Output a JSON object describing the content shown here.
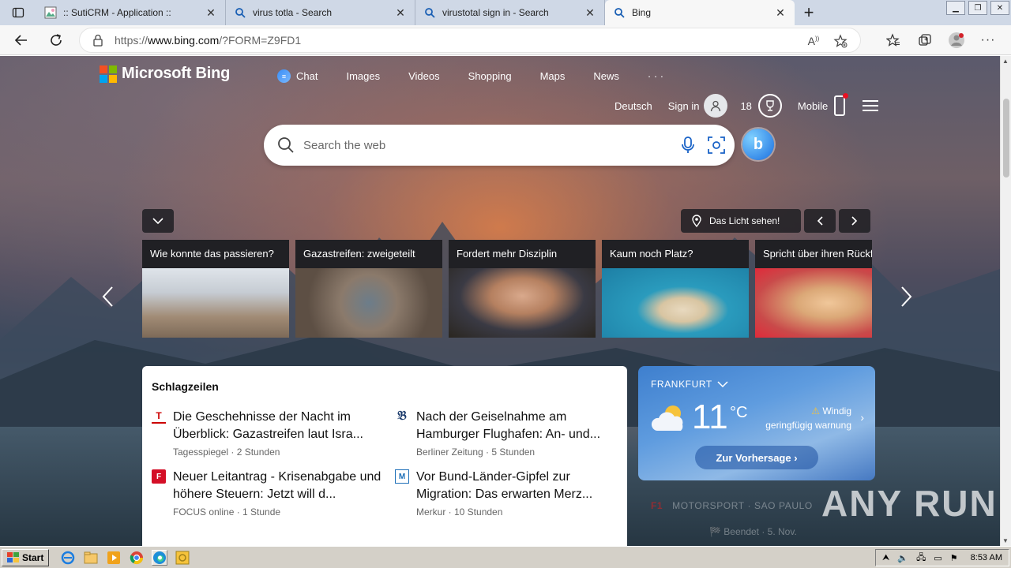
{
  "browser": {
    "tabs": [
      {
        "title": ":: SutiCRM - Application ::",
        "icon": "image-doc-icon"
      },
      {
        "title": "virus totla - Search",
        "icon": "search-icon"
      },
      {
        "title": "virustotal sign in - Search",
        "icon": "search-icon"
      },
      {
        "title": "Bing",
        "icon": "search-icon",
        "active": true
      }
    ],
    "address": {
      "url_prefix": "https://",
      "url_host": "www.bing.com",
      "url_path": "/?FORM=Z9FD1"
    }
  },
  "bing": {
    "logo_text": "Microsoft Bing",
    "nav": [
      "Chat",
      "Images",
      "Videos",
      "Shopping",
      "Maps",
      "News",
      "· · ·"
    ],
    "language": "Deutsch",
    "sign_in": "Sign in",
    "rewards_points": "18",
    "mobile": "Mobile",
    "search_placeholder": "Search the web",
    "location_pill": "Das Licht sehen!",
    "carousel": [
      {
        "caption": "Wie konnte das passieren?"
      },
      {
        "caption": "Gazastreifen: zweigeteilt"
      },
      {
        "caption": "Fordert mehr Disziplin"
      },
      {
        "caption": "Kaum noch Platz?"
      },
      {
        "caption": "Spricht über ihren Rückf"
      }
    ],
    "news": {
      "heading": "Schlagzeilen",
      "items": [
        {
          "title": "Die Geschehnisse der Nacht im Überblick: Gazastreifen laut Isra...",
          "meta": "Tagesspiegel · 2 Stunden",
          "icon": "T"
        },
        {
          "title": "Nach der Geiselnahme am Hamburger Flughafen: An- und...",
          "meta": "Berliner Zeitung · 5 Stunden",
          "icon": "B"
        },
        {
          "title": "Neuer Leitantrag - Krisenabgabe und höhere Steuern: Jetzt will d...",
          "meta": "FOCUS online · 1 Stunde",
          "icon": "F"
        },
        {
          "title": "Vor Bund-Länder-Gipfel zur Migration: Das erwarten Merz...",
          "meta": "Merkur · 10 Stunden",
          "icon": "M"
        }
      ]
    },
    "weather": {
      "city": "FRANKFURT",
      "temp": "11",
      "unit": "°C",
      "alert_title": "Windig",
      "alert_sub": "geringfügig warnung",
      "forecast_btn": "Zur Vorhersage ›"
    },
    "sports": {
      "line1": "MOTORSPORT · SAO PAULO",
      "line2": "Beendet · 5. Nov."
    },
    "watermark": "ANY RUN"
  },
  "taskbar": {
    "start": "Start",
    "clock": "8:53 AM"
  }
}
